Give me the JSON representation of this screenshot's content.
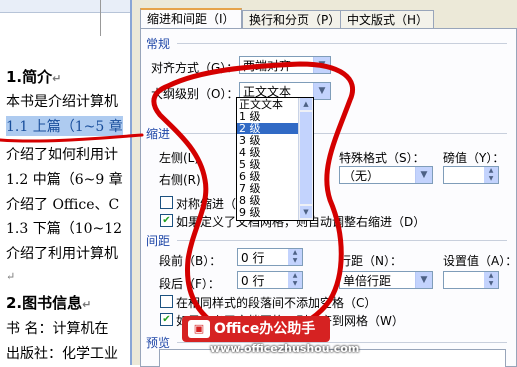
{
  "doc": {
    "lines": [
      {
        "text": "1.简介",
        "mark": "↵",
        "kind": "heading"
      },
      {
        "text": "本书是介绍计算机",
        "mark": "",
        "kind": "text"
      },
      {
        "text": "1.1 上篇（1~5 章",
        "mark": "",
        "kind": "selected"
      },
      {
        "text": "介绍了如何利用计",
        "mark": "",
        "kind": "text"
      },
      {
        "text": "1.2 中篇（6~9 章",
        "mark": "",
        "kind": "text"
      },
      {
        "text": "介绍了 Office、C",
        "mark": "",
        "kind": "text"
      },
      {
        "text": "1.3 下篇（10~12",
        "mark": "",
        "kind": "text"
      },
      {
        "text": "介绍了利用计算机",
        "mark": "",
        "kind": "text"
      },
      {
        "text": "",
        "mark": "↵",
        "kind": "text"
      },
      {
        "text": "2.图书信息",
        "mark": "↵",
        "kind": "heading"
      },
      {
        "text": "书 名：计算机在",
        "mark": "",
        "kind": "text"
      },
      {
        "text": "出版社：化学工业",
        "mark": "",
        "kind": "text"
      }
    ]
  },
  "dialog": {
    "tabs": [
      "缩进和间距（I）",
      "换行和分页（P）",
      "中文版式（H）"
    ],
    "general": {
      "section": "常规",
      "alignment_label": "对齐方式（G）：",
      "alignment_value": "两端对齐",
      "outline_label": "大纲级别（O）：",
      "outline_value": "正文文本"
    },
    "outline_options": [
      "正文文本",
      "1 级",
      "2 级",
      "3 级",
      "4 级",
      "5 级",
      "6 级",
      "7 级",
      "8 级",
      "9 级"
    ],
    "outline_selected_index": 2,
    "indent": {
      "section": "缩进",
      "left_label": "左侧(L)",
      "right_label": "右侧(R)",
      "special_label": "特殊格式（S）：",
      "special_value": "（无）",
      "degree_label": "磅值（Y）：",
      "mirror_label": "对称缩进（M）",
      "grid_label": "如果定义了文档网格，则自动调整右缩进（D）",
      "mirror_checked": false,
      "grid_checked": true
    },
    "spacing": {
      "section": "间距",
      "before_label": "段前（B）：",
      "before_value": "0 行",
      "after_label": "段后（F）：",
      "after_value": "0 行",
      "line_label": "行距（N）：",
      "line_value": "单倍行距",
      "at_label": "设置值（A）：",
      "no_space_label": "在相同样式的段落间不添加空格（C）",
      "snap_label": "如果定义了文档网格，则对齐到网格（W）",
      "no_space_checked": false,
      "snap_checked": true
    },
    "preview": {
      "section": "预览"
    }
  },
  "watermark": {
    "badge_text": "Office办公助手",
    "url": "www.officezhushou.com"
  },
  "colors": {
    "annotation": "#d40000",
    "accent": "#316ac5"
  }
}
